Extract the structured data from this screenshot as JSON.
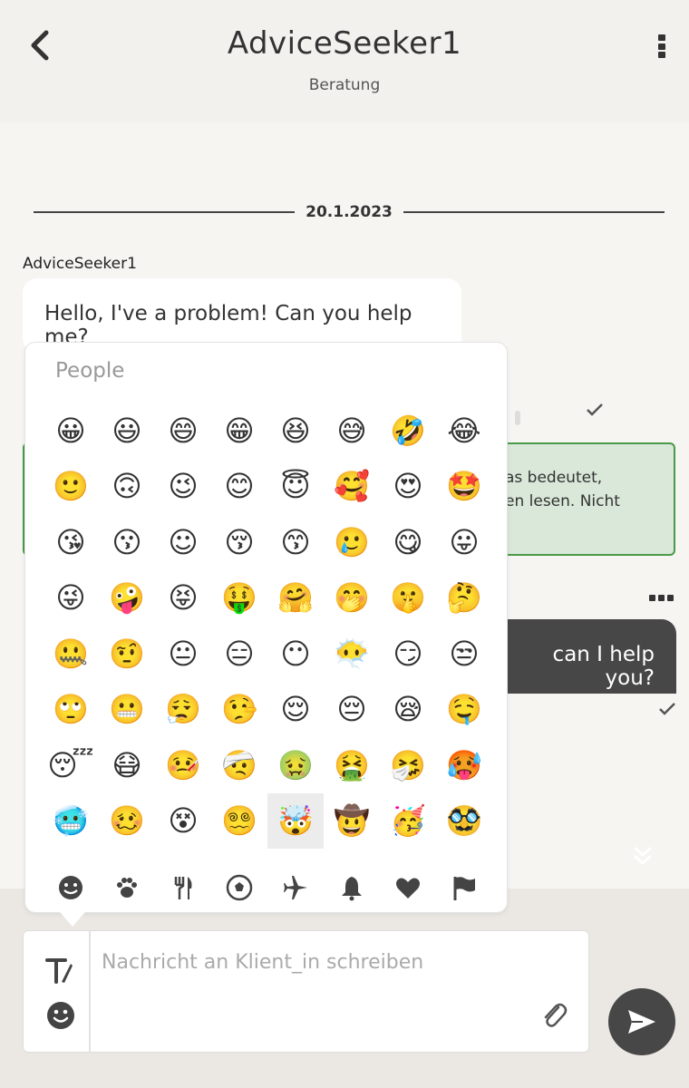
{
  "header": {
    "title": "AdviceSeeker1",
    "subtitle": "Beratung",
    "back_icon": "chevron-left-icon",
    "menu_icon": "more-vertical-icon"
  },
  "chat": {
    "date": "20.1.2023",
    "messages": [
      {
        "sender": "AdviceSeeker1",
        "text": "Hello, I've a problem! Can you help me?"
      }
    ],
    "system_notice_lines": [
      "as bedeutet,",
      "en lesen. Nicht"
    ],
    "outgoing_text": "can I help you?",
    "colors": {
      "accent": "#474747",
      "notice_bg": "#d9e8d9",
      "notice_border": "#4a9a4a"
    }
  },
  "emoji_picker": {
    "category": "People",
    "emojis": [
      "😀",
      "😃",
      "😄",
      "😁",
      "😆",
      "😅",
      "🤣",
      "😂",
      "🙂",
      "🙃",
      "😉",
      "😊",
      "😇",
      "🥰",
      "😍",
      "🤩",
      "😘",
      "😗",
      "☺",
      "😚",
      "😙",
      "🥲",
      "😋",
      "😛",
      "😜",
      "🤪",
      "😝",
      "🤑",
      "🤗",
      "🤭",
      "🤫",
      "🤔",
      "🤐",
      "🤨",
      "😐",
      "😑",
      "😶",
      "😶‍🌫️",
      "😏",
      "😒",
      "🙄",
      "😬",
      "😮‍💨",
      "🤥",
      "😌",
      "😔",
      "😪",
      "🤤",
      "😴",
      "😷",
      "🤒",
      "🤕",
      "🤢",
      "🤮",
      "🤧",
      "🥵",
      "🥶",
      "🥴",
      "😵",
      "😵‍💫",
      "🤯",
      "🤠",
      "🥳",
      "🥸"
    ],
    "selected_index": 60,
    "tabs": [
      "smiley-icon",
      "paw-icon",
      "cutlery-icon",
      "soccer-icon",
      "airplane-icon",
      "bell-icon",
      "heart-icon",
      "flag-icon"
    ]
  },
  "composer": {
    "placeholder": "Nachricht an Klient_in schreiben",
    "value": ""
  }
}
